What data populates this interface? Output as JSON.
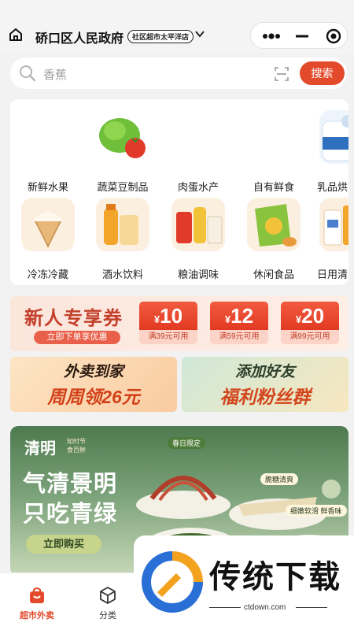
{
  "header": {
    "location": "硚口区人民政府",
    "store": "社区超市太平洋店"
  },
  "search": {
    "placeholder": "香蕉",
    "button": "搜索"
  },
  "categories": [
    {
      "label": "新鲜水果",
      "icon": "fresh-fruit"
    },
    {
      "label": "蔬菜豆制品",
      "icon": "vegetables"
    },
    {
      "label": "肉蛋水产",
      "icon": "meat-eggs-seafood"
    },
    {
      "label": "自有鲜食",
      "icon": "own-fresh-food"
    },
    {
      "label": "乳品烘",
      "icon": "dairy-bakery"
    },
    {
      "label": "冷冻冷藏",
      "icon": "frozen"
    },
    {
      "label": "酒水饮料",
      "icon": "drinks"
    },
    {
      "label": "粮油调味",
      "icon": "grain-oil"
    },
    {
      "label": "休闲食品",
      "icon": "snacks"
    },
    {
      "label": "日用清",
      "icon": "daily-cleaning"
    }
  ],
  "coupons": {
    "title": "新人专享券",
    "subtitle": "立即下单享优惠",
    "currency": "¥",
    "items": [
      {
        "amount": "10",
        "condition": "满39元可用"
      },
      {
        "amount": "12",
        "condition": "满59元可用"
      },
      {
        "amount": "20",
        "condition": "满99元可用"
      }
    ]
  },
  "promos": [
    {
      "line1": "外卖到家",
      "line2": "周周领26元"
    },
    {
      "line1": "添加好友",
      "line2": "福利粉丝群"
    }
  ],
  "banner": {
    "brand": "清明",
    "brand_sub1": "知时节",
    "brand_sub2": "食百鲜",
    "headline1": "气清景明",
    "headline2": "只吃青绿",
    "button": "立即购买",
    "tag_spring": "春日限定",
    "tag_crisp": "脆糖清爽",
    "tag_smooth": "细嫩软滑 鲜香味"
  },
  "tabbar": {
    "items": [
      {
        "label": "超市外卖",
        "active": true
      },
      {
        "label": "分类",
        "active": false
      }
    ]
  },
  "watermark": {
    "text": "传统下载",
    "url": "ctdown.com"
  },
  "colors": {
    "accent": "#e24a2b",
    "active_tab": "#e24a2b"
  }
}
